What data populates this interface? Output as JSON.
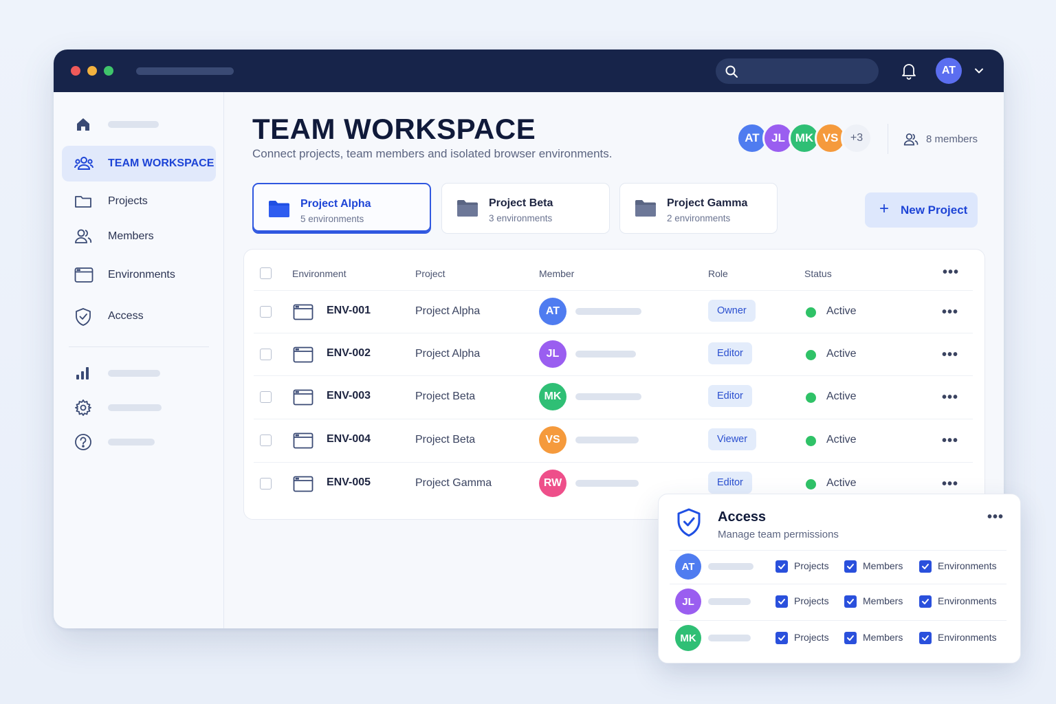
{
  "colors": {
    "titlebar": "#17244a",
    "accent": "#1d44d6",
    "active_status": "#2fc267",
    "avatar_AT": "#4f7cf0",
    "avatar_JL": "#9a5ef0",
    "avatar_MK": "#2fbf75",
    "avatar_VS": "#f59a3c",
    "avatar_RW": "#ee4f8a"
  },
  "topbar": {
    "user_initials": "AT",
    "icons": [
      "search-icon",
      "bell-icon",
      "chevron-down-icon"
    ]
  },
  "sidebar": {
    "items": [
      {
        "label": "",
        "icon": "home-icon"
      },
      {
        "label": "TEAM WORKSPACE",
        "icon": "team-icon",
        "active": true
      },
      {
        "label": "Projects",
        "icon": "folder-icon"
      },
      {
        "label": "Members",
        "icon": "members-icon"
      },
      {
        "label": "Environments",
        "icon": "browser-window-icon"
      },
      {
        "label": "Access",
        "icon": "shield-icon"
      }
    ],
    "secondary_icons": [
      "bar-chart-icon",
      "gear-icon",
      "help-icon"
    ]
  },
  "header": {
    "title": "TEAM WORKSPACE",
    "subtitle": "Connect projects, team members and isolated browser environments.",
    "stack": [
      "AT",
      "JL",
      "MK",
      "VS"
    ],
    "stack_more": "+3",
    "members_count": "8 members"
  },
  "projects": [
    {
      "name": "Project Alpha",
      "envs": "5 environments",
      "active": true
    },
    {
      "name": "Project Beta",
      "envs": "3 environments"
    },
    {
      "name": "Project Gamma",
      "envs": "2 environments"
    }
  ],
  "new_project_label": "New Project",
  "table": {
    "headers": {
      "environment": "Environment",
      "project": "Project",
      "member": "Member",
      "role": "Role",
      "status": "Status"
    },
    "rows": [
      {
        "env": "ENV-001",
        "project": "Project Alpha",
        "initials": "AT",
        "role": "Owner",
        "status": "Active"
      },
      {
        "env": "ENV-002",
        "project": "Project Alpha",
        "initials": "JL",
        "role": "Editor",
        "status": "Active"
      },
      {
        "env": "ENV-003",
        "project": "Project Beta",
        "initials": "MK",
        "role": "Editor",
        "status": "Active"
      },
      {
        "env": "ENV-004",
        "project": "Project Beta",
        "initials": "VS",
        "role": "Viewer",
        "status": "Active"
      },
      {
        "env": "ENV-005",
        "project": "Project Gamma",
        "initials": "RW",
        "role": "Editor",
        "status": "Active"
      }
    ]
  },
  "access_panel": {
    "title": "Access",
    "subtitle": "Manage team permissions",
    "perm_labels": [
      "Projects",
      "Members",
      "Environments"
    ],
    "rows": [
      {
        "initials": "AT",
        "perms": [
          true,
          true,
          true
        ]
      },
      {
        "initials": "JL",
        "perms": [
          true,
          true,
          true
        ]
      },
      {
        "initials": "MK",
        "perms": [
          true,
          true,
          true
        ]
      }
    ]
  }
}
